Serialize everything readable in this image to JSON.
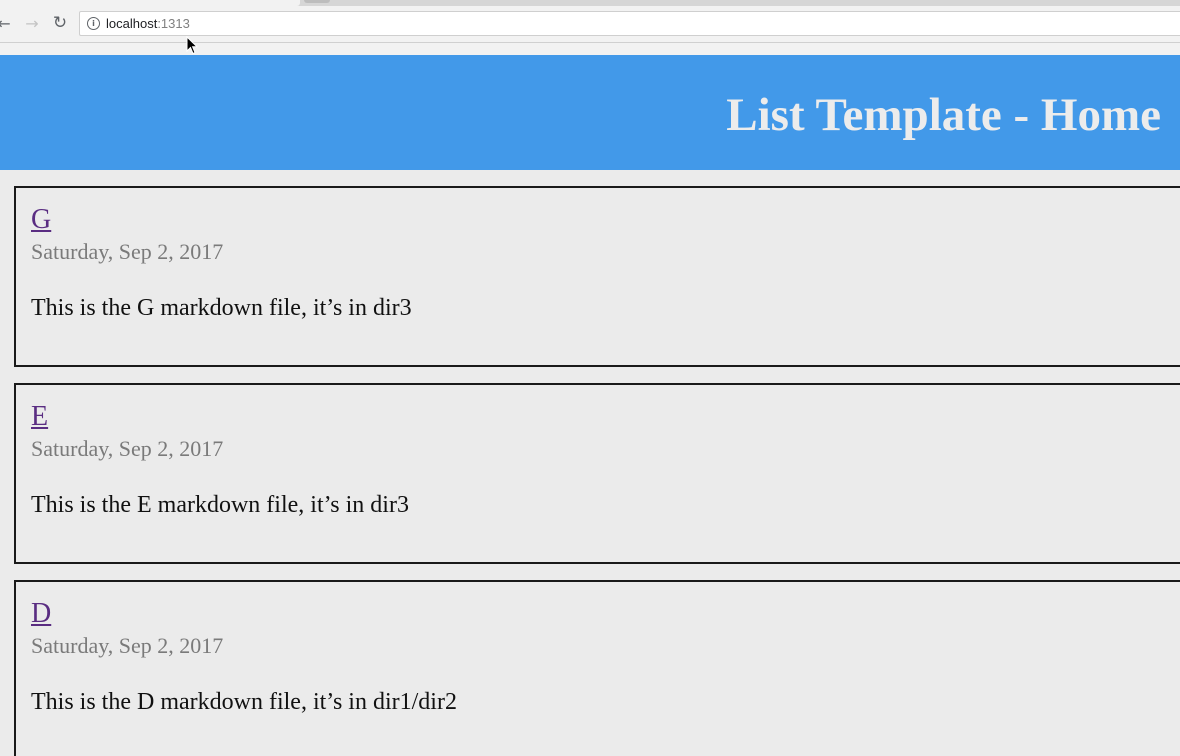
{
  "browser": {
    "url_host": "localhost",
    "url_port": ":1313",
    "icons": {
      "back": "back-arrow-icon",
      "forward": "forward-arrow-icon",
      "reload": "reload-icon",
      "info": "info-icon",
      "cursor": "mouse-pointer-icon"
    }
  },
  "site": {
    "title": "List Template - Home",
    "header_color": "#4299e9"
  },
  "posts": [
    {
      "title": "G",
      "date": "Saturday, Sep 2, 2017",
      "summary": "This is the G markdown file, it’s in dir3"
    },
    {
      "title": "E",
      "date": "Saturday, Sep 2, 2017",
      "summary": "This is the E markdown file, it’s in dir3"
    },
    {
      "title": "D",
      "date": "Saturday, Sep 2, 2017",
      "summary": "This is the D markdown file, it’s in dir1/dir2"
    }
  ],
  "colors": {
    "link": "#5a2d82",
    "date": "#7a7a7a",
    "page_background": "#ebebeb"
  }
}
